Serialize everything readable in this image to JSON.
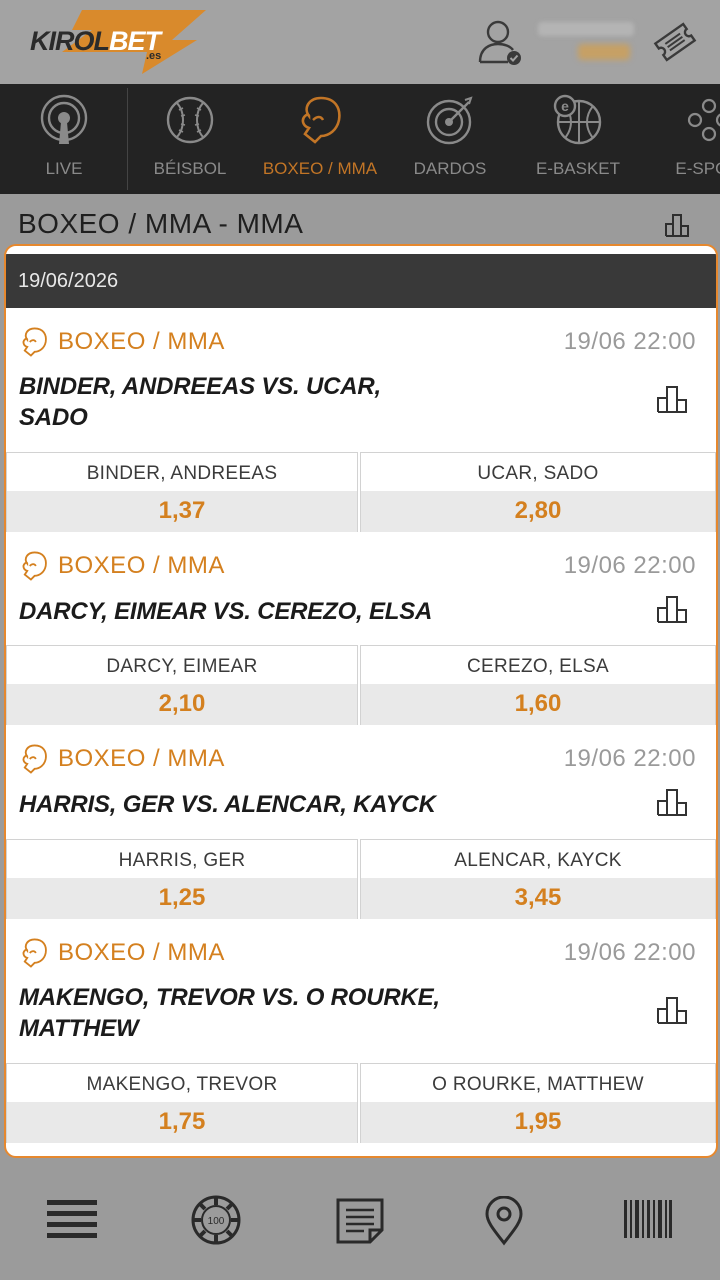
{
  "header": {
    "logo": {
      "main": "KIROL",
      "accent": "BET",
      "tld": ".es"
    },
    "icons": [
      "user-check-icon",
      "ticket-icon"
    ]
  },
  "sports_nav": [
    {
      "label": "LIVE",
      "icon": "live-broadcast-icon",
      "active": false
    },
    {
      "label": "BÉISBOL",
      "icon": "baseball-icon",
      "active": false
    },
    {
      "label": "BOXEO / MMA",
      "icon": "boxing-glove-icon",
      "active": true
    },
    {
      "label": "DARDOS",
      "icon": "dartboard-icon",
      "active": false
    },
    {
      "label": "E-BASKET",
      "icon": "e-basketball-icon",
      "active": false
    },
    {
      "label": "E-SPOR",
      "icon": "gamepad-icon",
      "active": false
    }
  ],
  "page": {
    "title": "BOXEO / MMA - MMA"
  },
  "date_group": {
    "date": "19/06/2026"
  },
  "events": [
    {
      "sport": "BOXEO / MMA",
      "time": "19/06 22:00",
      "match_line1": "BINDER, ANDREEAS VS. UCAR,",
      "match_line2": "SADO",
      "home": {
        "name": "BINDER, ANDREEAS",
        "odd": "1,37"
      },
      "away": {
        "name": "UCAR, SADO",
        "odd": "2,80"
      }
    },
    {
      "sport": "BOXEO / MMA",
      "time": "19/06 22:00",
      "match_line1": "DARCY, EIMEAR VS. CEREZO, ELSA",
      "match_line2": "",
      "home": {
        "name": "DARCY, EIMEAR",
        "odd": "2,10"
      },
      "away": {
        "name": "CEREZO, ELSA",
        "odd": "1,60"
      }
    },
    {
      "sport": "BOXEO / MMA",
      "time": "19/06 22:00",
      "match_line1": "HARRIS, GER VS. ALENCAR, KAYCK",
      "match_line2": "",
      "home": {
        "name": "HARRIS, GER",
        "odd": "1,25"
      },
      "away": {
        "name": "ALENCAR, KAYCK",
        "odd": "3,45"
      }
    },
    {
      "sport": "BOXEO / MMA",
      "time": "19/06 22:00",
      "match_line1": "MAKENGO, TREVOR VS. O ROURKE,",
      "match_line2": "MATTHEW",
      "home": {
        "name": "MAKENGO, TREVOR",
        "odd": "1,75"
      },
      "away": {
        "name": "O ROURKE, MATTHEW",
        "odd": "1,95"
      }
    }
  ],
  "bottom_bar": [
    {
      "icon": "menu-icon"
    },
    {
      "icon": "casino-chip-icon",
      "chip_label": "100"
    },
    {
      "icon": "document-icon"
    },
    {
      "icon": "location-pin-icon"
    },
    {
      "icon": "barcode-icon"
    }
  ],
  "colors": {
    "accent": "#d4801f",
    "dark": "#232323",
    "panel_border": "#e6882e"
  }
}
